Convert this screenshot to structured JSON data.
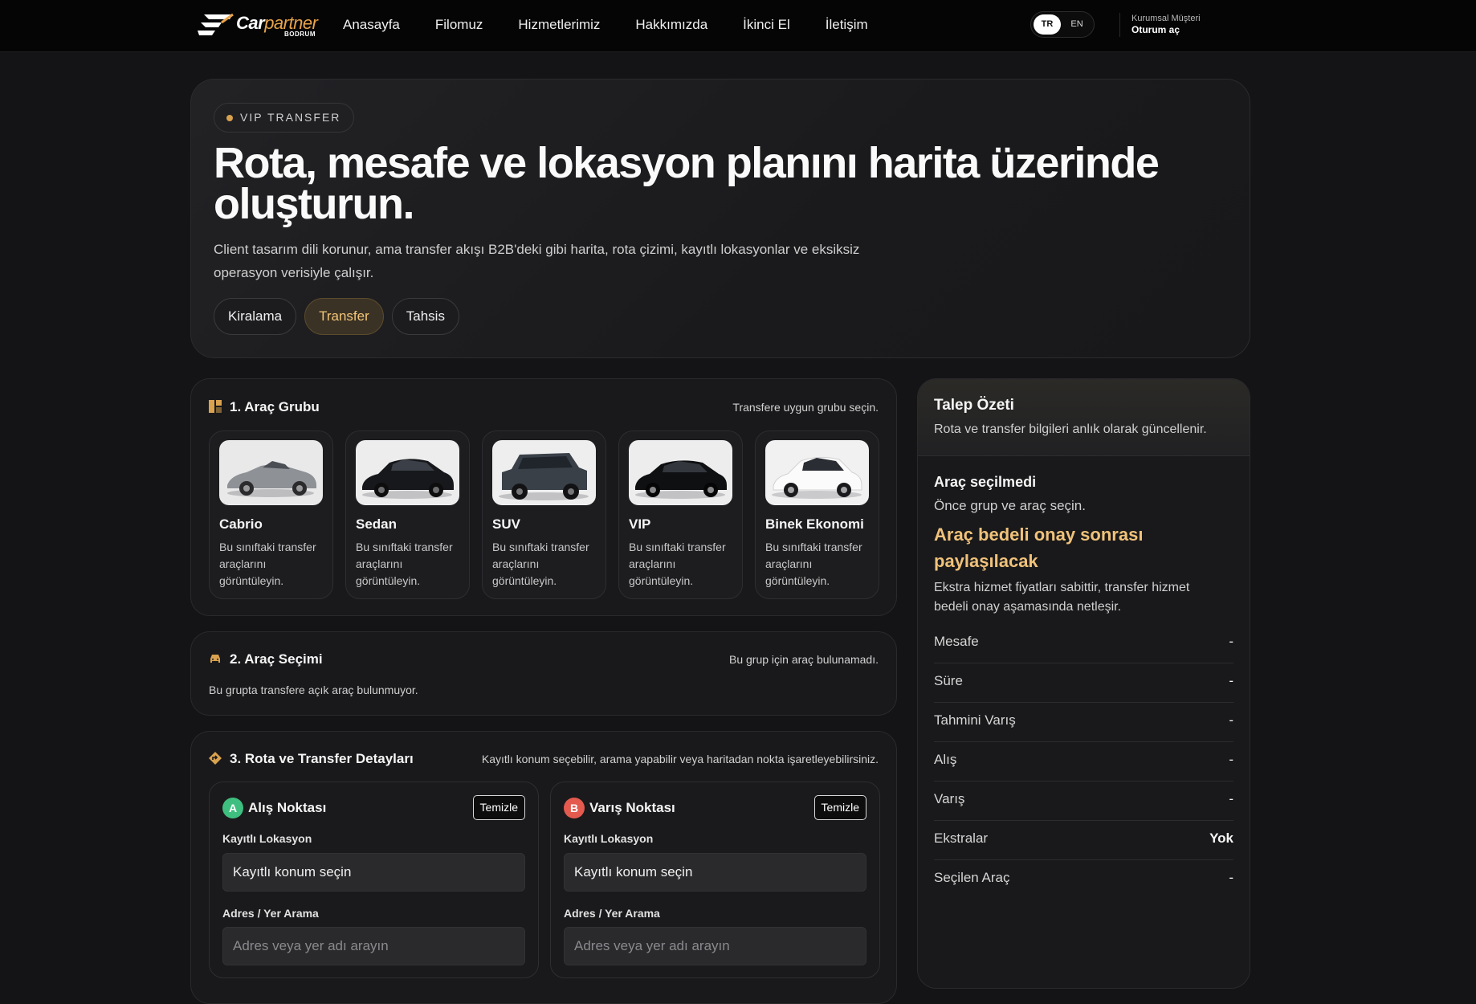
{
  "nav": {
    "logo_main": "Car",
    "logo_accent": "partner",
    "logo_sub": "BODRUM",
    "links": [
      "Anasayfa",
      "Filomuz",
      "Hizmetlerimiz",
      "Hakkımızda",
      "İkinci El",
      "İletişim"
    ],
    "lang_tr": "TR",
    "lang_en": "EN",
    "account_label": "Kurumsal Müşteri",
    "account_action": "Oturum aç"
  },
  "hero": {
    "badge": "VIP TRANSFER",
    "title": "Rota, mesafe ve lokasyon planını harita üzerinde oluşturun.",
    "description": "Client tasarım dili korunur, ama transfer akışı B2B'deki gibi harita, rota çizimi, kayıtlı lokasyonlar ve eksiksiz operasyon verisiyle çalışır.",
    "tabs": [
      "Kiralama",
      "Transfer",
      "Tahsis"
    ],
    "active_tab": "Transfer"
  },
  "group_section": {
    "title": "1. Araç Grubu",
    "hint": "Transfere uygun grubu seçin.",
    "groups": [
      {
        "name": "Cabrio",
        "desc": "Bu sınıftaki transfer araçlarını görüntüleyin."
      },
      {
        "name": "Sedan",
        "desc": "Bu sınıftaki transfer araçlarını görüntüleyin."
      },
      {
        "name": "SUV",
        "desc": "Bu sınıftaki transfer araçlarını görüntüleyin."
      },
      {
        "name": "VIP",
        "desc": "Bu sınıftaki transfer araçlarını görüntüleyin."
      },
      {
        "name": "Binek Ekonomi",
        "desc": "Bu sınıftaki transfer araçlarını görüntüleyin."
      }
    ]
  },
  "vehicle_section": {
    "title": "2. Araç Seçimi",
    "hint": "Bu grup için araç bulunamadı.",
    "empty": "Bu grupta transfere açık araç bulunmuyor."
  },
  "route_section": {
    "title": "3. Rota ve Transfer Detayları",
    "hint": "Kayıtlı konum seçebilir, arama yapabilir veya haritadan nokta işaretleyebilirsiniz.",
    "pickup": {
      "marker": "A",
      "title": "Alış Noktası",
      "clear": "Temizle",
      "saved_label": "Kayıtlı Lokasyon",
      "saved_value": "Kayıtlı konum seçin",
      "search_label": "Adres / Yer Arama",
      "search_placeholder": "Adres veya yer adı arayın"
    },
    "dropoff": {
      "marker": "B",
      "title": "Varış Noktası",
      "clear": "Temizle",
      "saved_label": "Kayıtlı Lokasyon",
      "saved_value": "Kayıtlı konum seçin",
      "search_label": "Adres / Yer Arama",
      "search_placeholder": "Adres veya yer adı arayın"
    }
  },
  "summary": {
    "title": "Talep Özeti",
    "subtitle": "Rota ve transfer bilgileri anlık olarak güncellenir.",
    "vehicle_title": "Araç seçilmedi",
    "vehicle_sub": "Önce grup ve araç seçin.",
    "price_note": "Araç bedeli onay sonrası paylaşılacak",
    "price_desc": "Ekstra hizmet fiyatları sabittir, transfer hizmet bedeli onay aşamasında netleşir.",
    "rows": [
      {
        "label": "Mesafe",
        "value": "-"
      },
      {
        "label": "Süre",
        "value": "-"
      },
      {
        "label": "Tahmini Varış",
        "value": "-"
      },
      {
        "label": "Alış",
        "value": "-"
      },
      {
        "label": "Varış",
        "value": "-"
      },
      {
        "label": "Ekstralar",
        "value": "Yok"
      },
      {
        "label": "Seçilen Araç",
        "value": "-"
      }
    ]
  },
  "colors": {
    "accent": "#f0c27a",
    "pickup_marker": "#3fbf7f",
    "dropoff_marker": "#e45a4f",
    "background": "#141416"
  }
}
